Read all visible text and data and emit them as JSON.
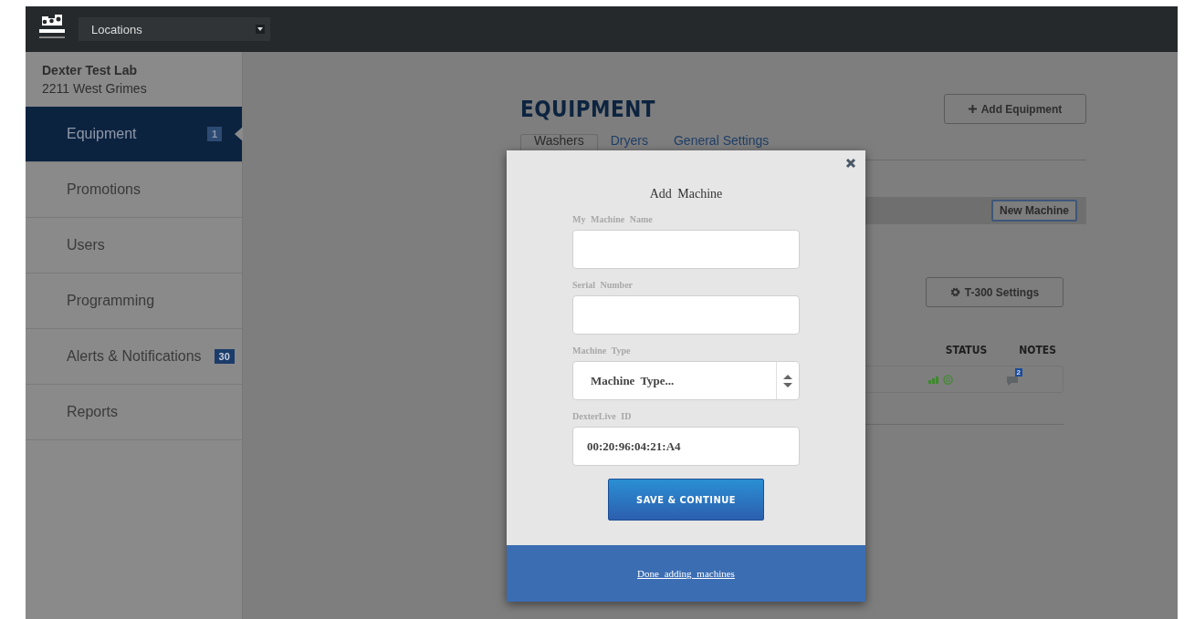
{
  "topbar": {
    "location_select": "Locations"
  },
  "sidebar": {
    "location_name": "Dexter Test Lab",
    "address": "2211 West Grimes",
    "items": [
      {
        "label": "Equipment",
        "badge": "1",
        "selected": true
      },
      {
        "label": "Promotions",
        "selected": false
      },
      {
        "label": "Users",
        "selected": false
      },
      {
        "label": "Programming",
        "selected": false
      },
      {
        "label": "Alerts & Notifications",
        "badge": "30",
        "selected": false
      },
      {
        "label": "Reports",
        "selected": false
      }
    ]
  },
  "page": {
    "title": "EQUIPMENT",
    "add_button": "Add Equipment",
    "tabs": [
      {
        "label": "Washers",
        "selected": true
      },
      {
        "label": "Dryers",
        "selected": false
      },
      {
        "label": "General Settings",
        "selected": false
      }
    ],
    "new_machine_button": "New Machine",
    "settings_button": "T-300 Settings",
    "columns": [
      "STATUS",
      "NOTES"
    ],
    "notes_count": "2"
  },
  "modal": {
    "title": "Add Machine",
    "fields": [
      {
        "kind": "text",
        "label": "My Machine Name"
      },
      {
        "kind": "text",
        "label": "Serial Number"
      },
      {
        "kind": "select",
        "label": "Machine Type",
        "value": "Machine Type..."
      },
      {
        "kind": "text",
        "label": "DexterLive ID",
        "value": "00:20:96:04:21:A4"
      }
    ],
    "submit_button": "SAVE & CONTINUE",
    "footer_link": "Done adding machines"
  }
}
